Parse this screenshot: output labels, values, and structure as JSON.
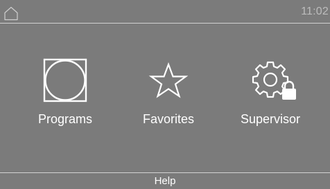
{
  "status_bar": {
    "home_icon": "home-outline-icon",
    "time": "11:02"
  },
  "main_menu": {
    "tiles": [
      {
        "label": "Programs",
        "icon": "dryer-drum-icon"
      },
      {
        "label": "Favorites",
        "icon": "star-outline-icon"
      },
      {
        "label": "Supervisor",
        "icon": "gear-lock-icon"
      }
    ]
  },
  "footer": {
    "help_label": "Help"
  },
  "colors": {
    "background": "#7b7b7b",
    "foreground": "#ffffff",
    "clock_text": "#bdbdbd",
    "divider": "#d2d2d2"
  }
}
